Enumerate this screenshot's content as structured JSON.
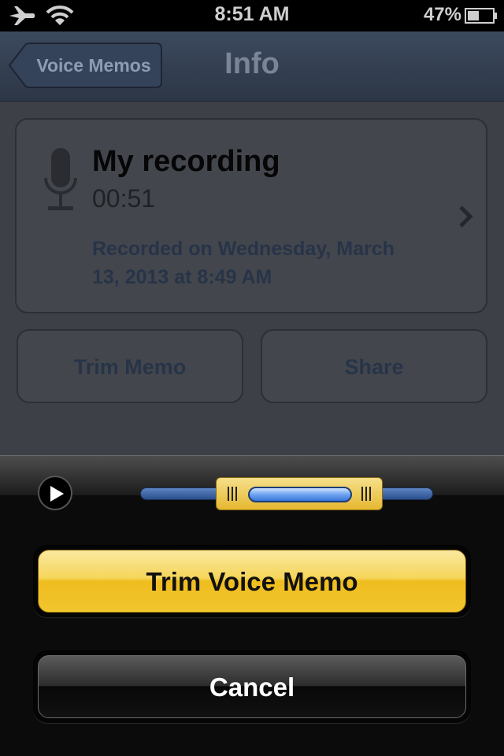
{
  "status_bar": {
    "time": "8:51 AM",
    "battery_percent": "47%",
    "battery_level": 0.47
  },
  "nav": {
    "back_label": "Voice Memos",
    "title": "Info"
  },
  "recording": {
    "name": "My recording",
    "duration": "00:51",
    "date_line1": "Recorded on Wednesday, March",
    "date_line2": "13, 2013 at 8:49 AM"
  },
  "actions": {
    "trim_label": "Trim Memo",
    "share_label": "Share"
  },
  "sheet": {
    "confirm_label": "Trim Voice Memo",
    "cancel_label": "Cancel"
  },
  "colors": {
    "accent_yellow": "#f2c52e",
    "track_blue": "#2a4f8c"
  },
  "icons": [
    "airplane-icon",
    "wifi-icon",
    "battery-icon",
    "microphone-icon",
    "chevron-right-icon",
    "play-icon",
    "grip-icon"
  ]
}
